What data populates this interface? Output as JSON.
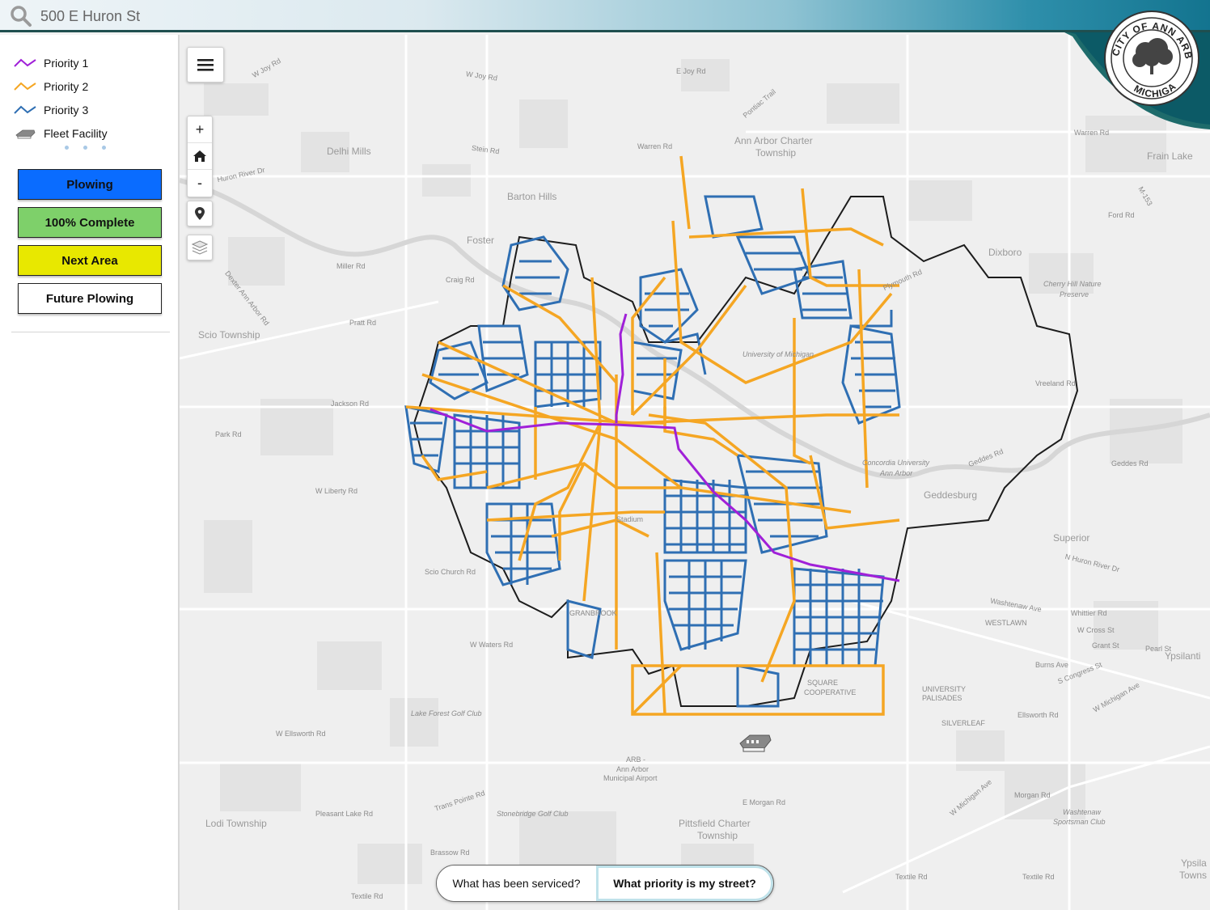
{
  "search": {
    "value": "500 E Huron St"
  },
  "seal": {
    "top_text": "CITY OF ANN ARBOR",
    "bottom_text": "MICHIGAN"
  },
  "legend": {
    "items": [
      {
        "label": "Priority 1",
        "color": "#a020d8",
        "icon": "zigzag-line-icon"
      },
      {
        "label": "Priority 2",
        "color": "#f5a623",
        "icon": "zigzag-line-icon"
      },
      {
        "label": "Priority 3",
        "color": "#2f6fb3",
        "icon": "zigzag-line-icon"
      },
      {
        "label": "Fleet Facility",
        "color": "#777777",
        "icon": "building-icon"
      }
    ]
  },
  "status_buttons": [
    {
      "label": "Plowing",
      "color": "#0a6cff"
    },
    {
      "label": "100% Complete",
      "color": "#7ed06a"
    },
    {
      "label": "Next Area",
      "color": "#e8e800"
    },
    {
      "label": "Future Plowing",
      "color": "#ffffff"
    }
  ],
  "map_controls": {
    "zoom_in": "+",
    "zoom_out": "-"
  },
  "toggle": {
    "option_a": "What has been serviced?",
    "option_b": "What priority is my street?"
  },
  "map_labels": [
    {
      "text": "W Joy Rd"
    },
    {
      "text": "W Joy Rd"
    },
    {
      "text": "E Joy Rd"
    },
    {
      "text": "Delhi Mills"
    },
    {
      "text": "Huron River Dr"
    },
    {
      "text": "Stein Rd"
    },
    {
      "text": "Warren Rd"
    },
    {
      "text": "Ann Arbor Charter"
    },
    {
      "text": "Township"
    },
    {
      "text": "Barton Hills"
    },
    {
      "text": "Foster"
    },
    {
      "text": "Miller Rd"
    },
    {
      "text": "Craig Rd"
    },
    {
      "text": "Dexter Ann Arbor Rd"
    },
    {
      "text": "Pratt Rd"
    },
    {
      "text": "Scio Township"
    },
    {
      "text": "Jackson Rd"
    },
    {
      "text": "Park Rd"
    },
    {
      "text": "W Liberty Rd"
    },
    {
      "text": "Scio Church Rd"
    },
    {
      "text": "W Waters Rd"
    },
    {
      "text": "W Ellsworth Rd"
    },
    {
      "text": "Lake Forest Golf Club"
    },
    {
      "text": "ARB -"
    },
    {
      "text": "Ann Arbor"
    },
    {
      "text": "Municipal Airport"
    },
    {
      "text": "Lodi Township"
    },
    {
      "text": "Pleasant Lake Rd"
    },
    {
      "text": "Stonebridge Golf Club"
    },
    {
      "text": "Pittsfield Charter"
    },
    {
      "text": "Township"
    },
    {
      "text": "E Morgan Rd"
    },
    {
      "text": "Brassow Rd"
    },
    {
      "text": "Textile Rd"
    },
    {
      "text": "Textile Rd"
    },
    {
      "text": "Textile Rd"
    },
    {
      "text": "Plymouth Rd"
    },
    {
      "text": "Dixboro"
    },
    {
      "text": "Cherry Hill Nature"
    },
    {
      "text": "Preserve"
    },
    {
      "text": "Vreeland Rd"
    },
    {
      "text": "Geddes Rd"
    },
    {
      "text": "Geddes Rd"
    },
    {
      "text": "Geddesburg"
    },
    {
      "text": "Superior"
    },
    {
      "text": "N Huron River Dr"
    },
    {
      "text": "Washtenaw Ave"
    },
    {
      "text": "Whittier Rd"
    },
    {
      "text": "WESTLAWN"
    },
    {
      "text": "W Cross St"
    },
    {
      "text": "Grant St"
    },
    {
      "text": "Pearl St"
    },
    {
      "text": "Ypsilanti"
    },
    {
      "text": "Burns Ave"
    },
    {
      "text": "S Congress St"
    },
    {
      "text": "W Michigan Ave"
    },
    {
      "text": "UNIVERSITY"
    },
    {
      "text": "PALISADES"
    },
    {
      "text": "Ellsworth Rd"
    },
    {
      "text": "SILVERLEAF"
    },
    {
      "text": "Morgan Rd"
    },
    {
      "text": "Washtenaw"
    },
    {
      "text": "Sportsman Club"
    },
    {
      "text": "Ypsila"
    },
    {
      "text": "Towns"
    },
    {
      "text": "Ford Rd"
    },
    {
      "text": "Frain Lake"
    },
    {
      "text": "Warren Rd"
    },
    {
      "text": "Pontiac Trail"
    },
    {
      "text": "Concordia University"
    },
    {
      "text": "Ann Arbor"
    },
    {
      "text": "University of Michigan"
    },
    {
      "text": "GRANBROOK"
    },
    {
      "text": "SQUARE"
    },
    {
      "text": "COOPERATIVE"
    },
    {
      "text": "Stadium"
    },
    {
      "text": "Trans Pointe Rd"
    },
    {
      "text": "M-153"
    },
    {
      "text": "W Michigan Ave"
    }
  ]
}
